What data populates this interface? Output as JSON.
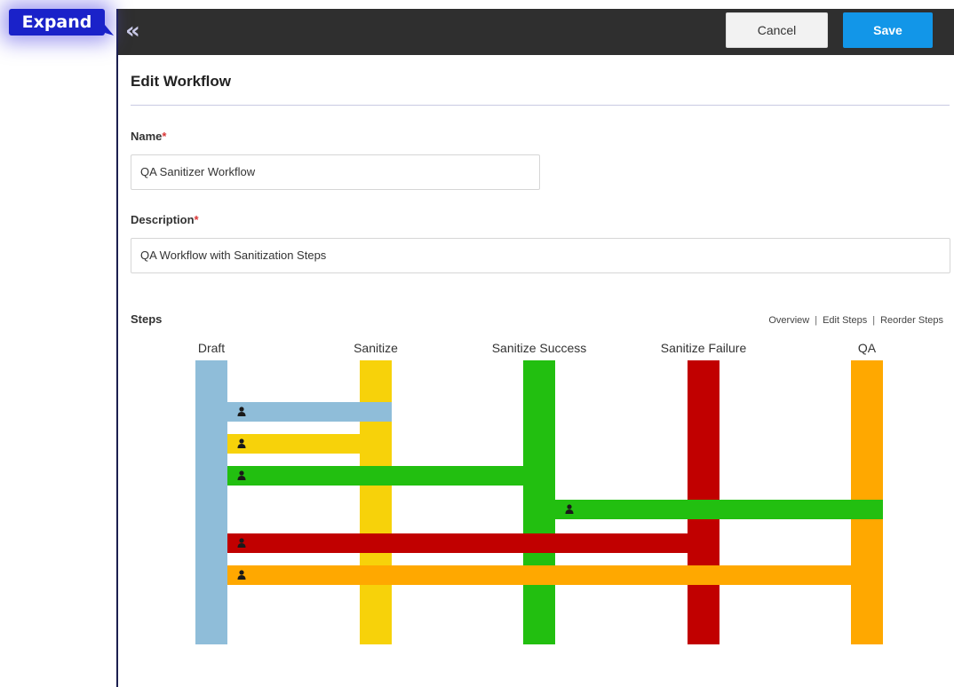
{
  "expand": {
    "label": "Expand"
  },
  "toolbar": {
    "collapse_glyph": "«",
    "cancel_label": "Cancel",
    "save_label": "Save"
  },
  "page": {
    "title": "Edit Workflow"
  },
  "form": {
    "name": {
      "label": "Name",
      "required_mark": "*",
      "value": "QA Sanitizer Workflow"
    },
    "description": {
      "label": "Description",
      "required_mark": "*",
      "value": "QA Workflow with Sanitization Steps"
    }
  },
  "steps": {
    "label": "Steps",
    "links": [
      "Overview",
      "Edit Steps",
      "Reorder Steps"
    ],
    "separator": "|",
    "columns": [
      {
        "name": "Draft",
        "color": "#8fbdd9"
      },
      {
        "name": "Sanitize",
        "color": "#f7d20a"
      },
      {
        "name": "Sanitize Success",
        "color": "#22bf10"
      },
      {
        "name": "Sanitize Failure",
        "color": "#c10000"
      },
      {
        "name": "QA",
        "color": "#ffa800"
      }
    ],
    "transitions": [
      {
        "from": "Draft",
        "to": "Sanitize",
        "color": "#8fbdd9",
        "icon": "user-icon"
      },
      {
        "from": "Sanitize",
        "to": "Draft",
        "color": "#f7d20a",
        "icon": "user-icon"
      },
      {
        "from": "Sanitize Success",
        "to": "Draft",
        "color": "#22bf10",
        "icon": "user-icon"
      },
      {
        "from": "Sanitize Success",
        "to": "QA",
        "color": "#22bf10",
        "icon": "user-icon"
      },
      {
        "from": "Sanitize Failure",
        "to": "Draft",
        "color": "#c10000",
        "icon": "user-icon"
      },
      {
        "from": "QA",
        "to": "Draft",
        "color": "#ffa800",
        "icon": "user-icon"
      }
    ]
  }
}
